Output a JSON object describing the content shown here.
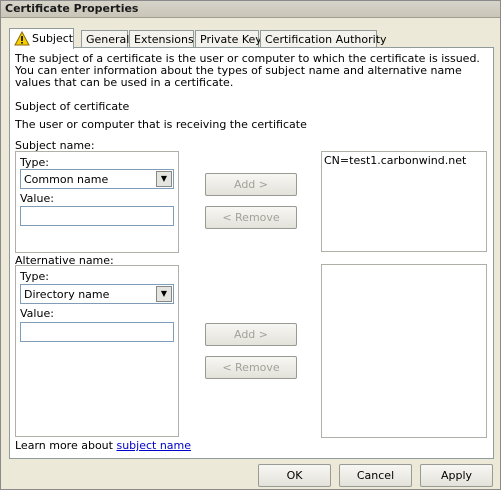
{
  "window": {
    "title": "Certificate Properties"
  },
  "tabs": [
    {
      "label": "Subject",
      "active": true
    },
    {
      "label": "General"
    },
    {
      "label": "Extensions"
    },
    {
      "label": "Private Key"
    },
    {
      "label": "Certification Authority"
    }
  ],
  "subject_tab": {
    "intro": "The subject of a certificate is the user or computer to which the certificate is issued. You can enter information about the types of subject name and alternative name values that can be used in a certificate.",
    "heading": "Subject of certificate",
    "description": "The user or computer that is receiving the certificate",
    "subject_name": {
      "label": "Subject name:",
      "type_label": "Type:",
      "type_value": "Common name",
      "value_label": "Value:",
      "value": "",
      "add_label": "Add >",
      "remove_label": "< Remove",
      "list": [
        "CN=test1.carbonwind.net"
      ]
    },
    "alternative_name": {
      "label": "Alternative name:",
      "type_label": "Type:",
      "type_value": "Directory name",
      "value_label": "Value:",
      "value": "",
      "add_label": "Add >",
      "remove_label": "< Remove",
      "list": []
    },
    "learn_more_prefix": "Learn more about",
    "learn_more_link": "subject name"
  },
  "buttons": {
    "ok": "OK",
    "cancel": "Cancel",
    "apply": "Apply"
  },
  "colors": {
    "dialog_bg": "#ece9d8",
    "link": "#0000cc",
    "disabled_text": "#a2a29b"
  }
}
